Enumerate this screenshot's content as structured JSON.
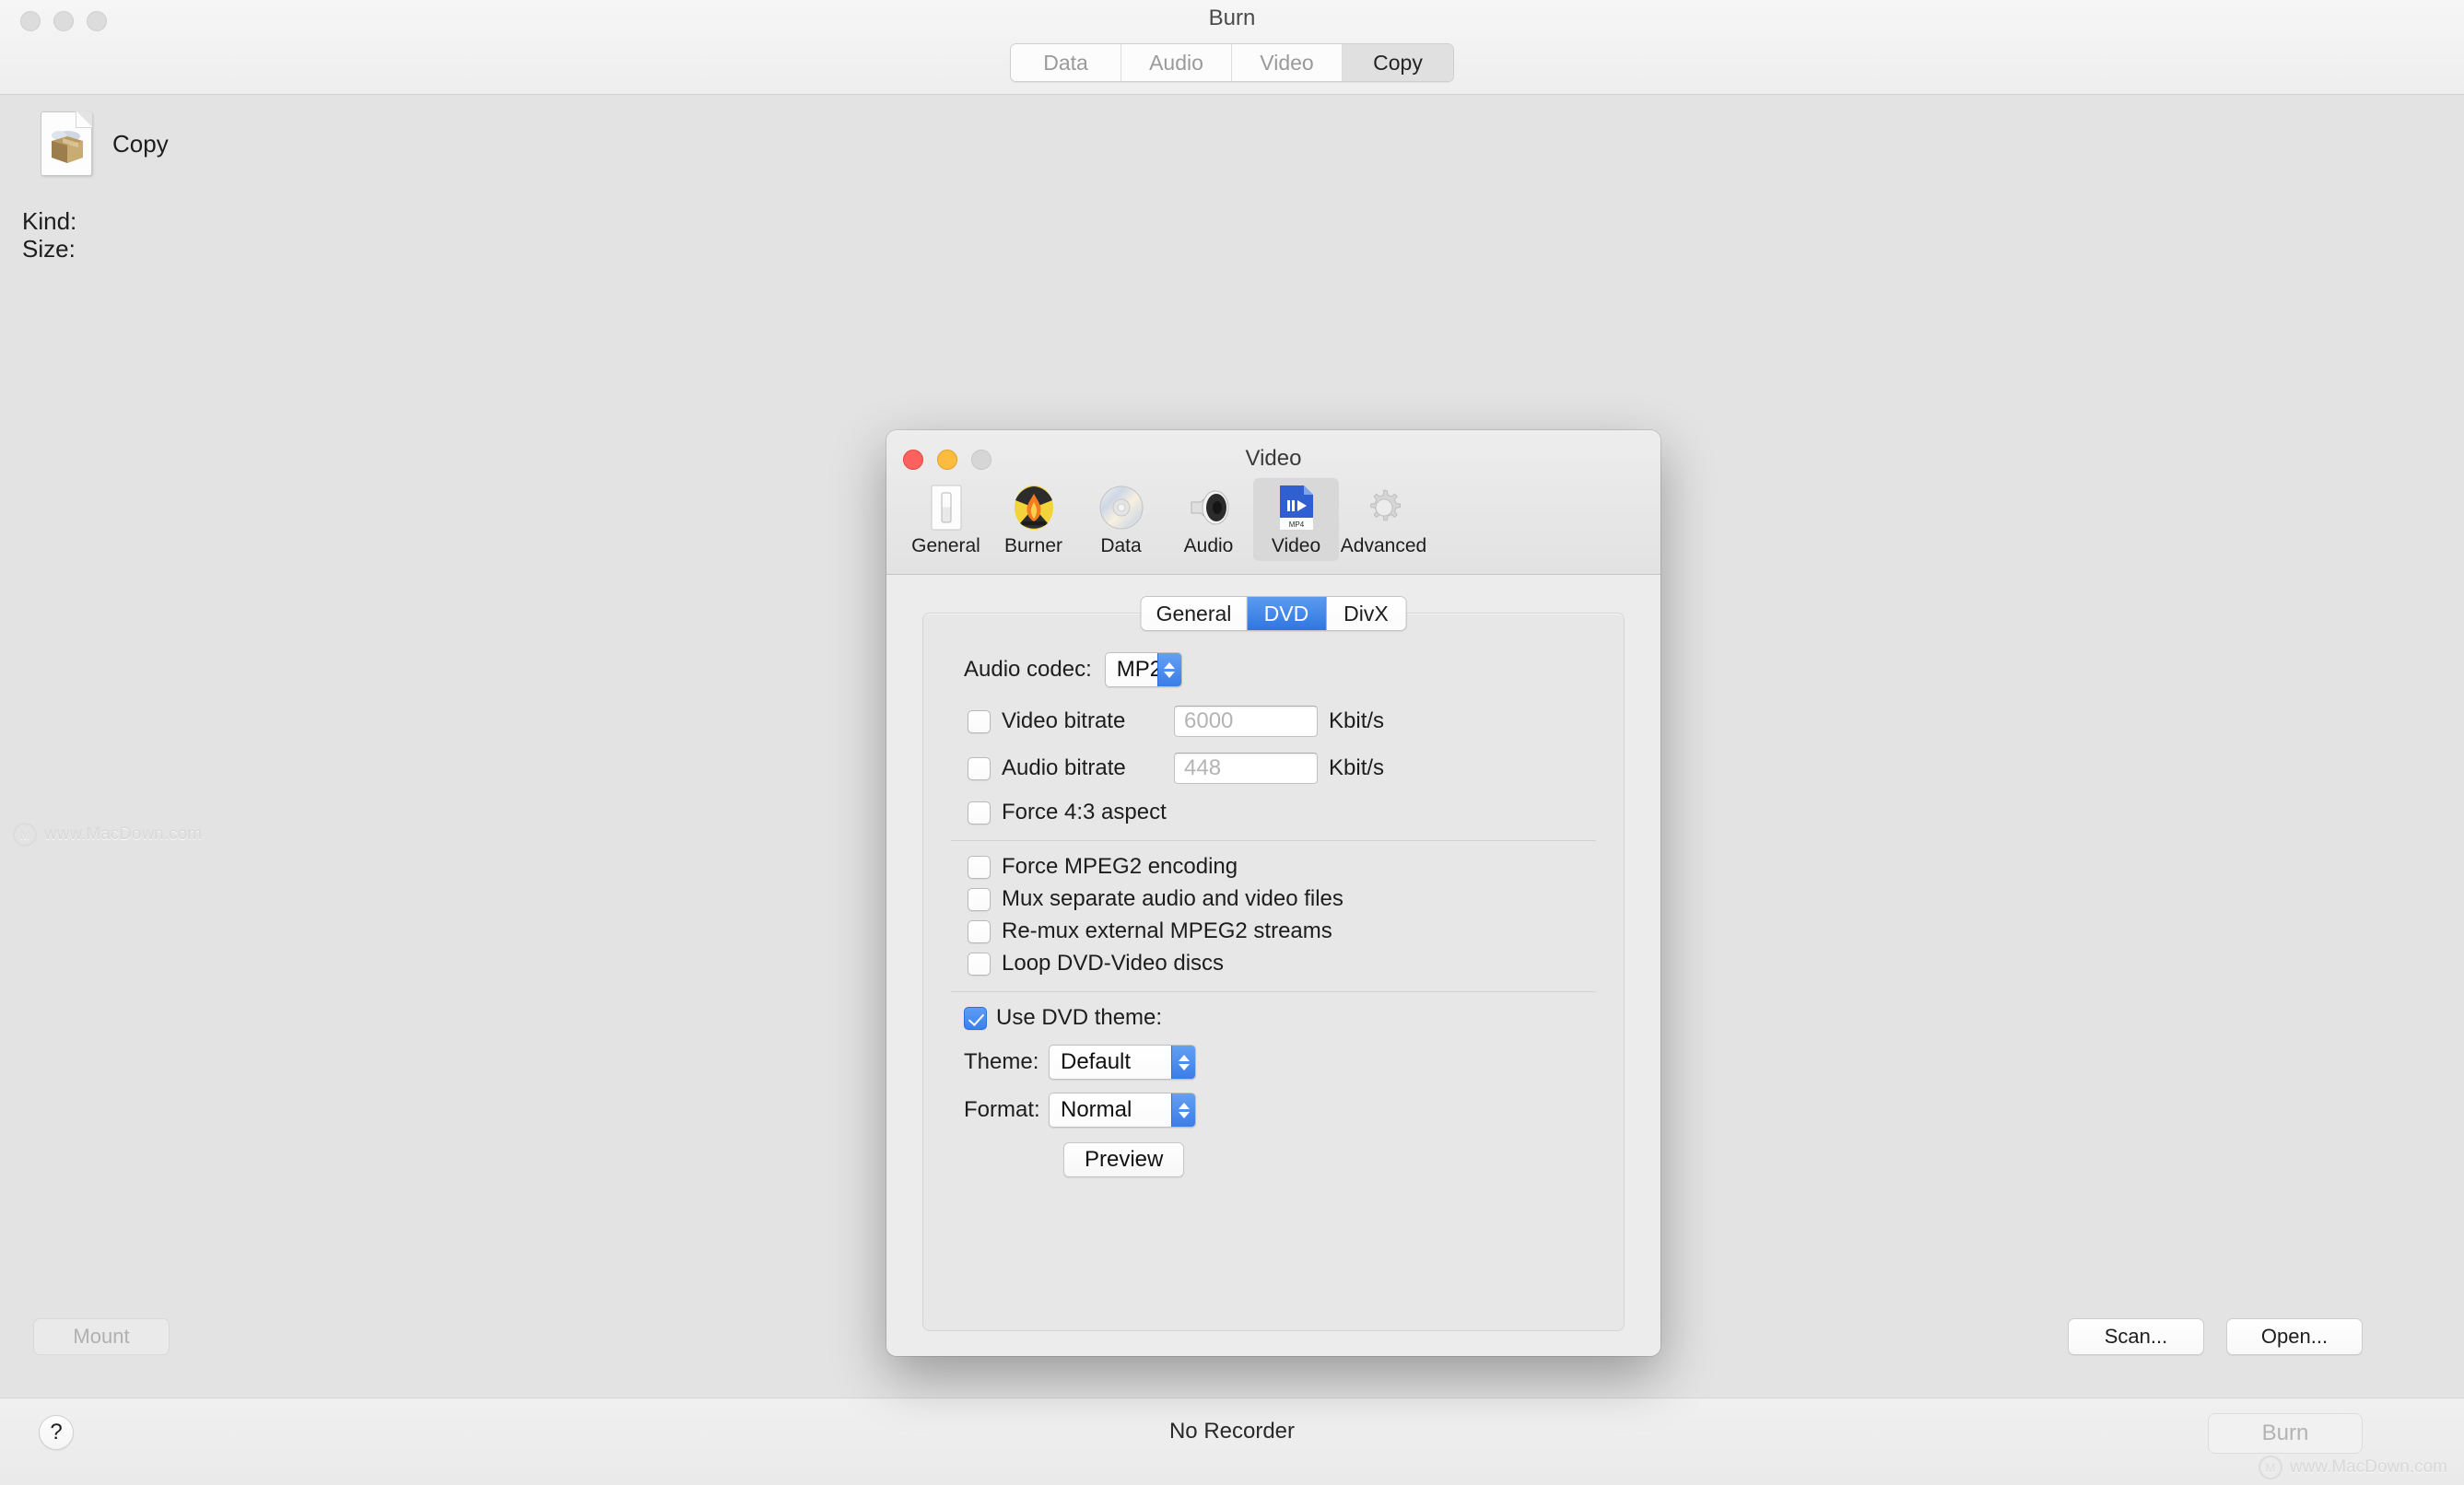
{
  "main_window": {
    "title": "Burn",
    "tabs": [
      {
        "label": "Data",
        "active": false
      },
      {
        "label": "Audio",
        "active": false
      },
      {
        "label": "Video",
        "active": false
      },
      {
        "label": "Copy",
        "active": true
      }
    ],
    "document": {
      "name": "Copy",
      "icon": "document-box-icon"
    },
    "fields": [
      {
        "label": "Kind:",
        "value": ""
      },
      {
        "label": "Size:",
        "value": ""
      }
    ],
    "kind_label": "Kind:",
    "size_label": "Size:",
    "mount_button": "Mount",
    "scan_button": "Scan...",
    "open_button": "Open...",
    "help_button": "?",
    "status": "No Recorder",
    "burn_button": "Burn",
    "watermark": "www.MacDown.com"
  },
  "prefs_window": {
    "title": "Video",
    "toolbar": [
      {
        "label": "General",
        "icon": "switch-icon",
        "selected": false
      },
      {
        "label": "Burner",
        "icon": "flame-icon",
        "selected": false
      },
      {
        "label": "Data",
        "icon": "cd-disc-icon",
        "selected": false
      },
      {
        "label": "Audio",
        "icon": "speaker-icon",
        "selected": false
      },
      {
        "label": "Video",
        "icon": "mp4-file-icon",
        "selected": true
      },
      {
        "label": "Advanced",
        "icon": "gear-icon",
        "selected": false
      }
    ],
    "inner_tabs": [
      {
        "label": "General",
        "active": false
      },
      {
        "label": "DVD",
        "active": true
      },
      {
        "label": "DivX",
        "active": false
      }
    ],
    "dvd_panel": {
      "audio_codec_label": "Audio codec:",
      "audio_codec_value": "MP2",
      "video_bitrate_label": "Video bitrate",
      "video_bitrate_checked": false,
      "video_bitrate_placeholder": "6000",
      "video_bitrate_unit": "Kbit/s",
      "audio_bitrate_label": "Audio bitrate",
      "audio_bitrate_checked": false,
      "audio_bitrate_placeholder": "448",
      "audio_bitrate_unit": "Kbit/s",
      "force_43_label": "Force 4:3 aspect",
      "force_43_checked": false,
      "options": [
        {
          "label": "Force MPEG2 encoding",
          "checked": false
        },
        {
          "label": "Mux separate audio and video files",
          "checked": false
        },
        {
          "label": "Re-mux external MPEG2 streams",
          "checked": false
        },
        {
          "label": "Loop DVD-Video discs",
          "checked": false
        }
      ],
      "use_dvd_theme_label": "Use DVD theme:",
      "use_dvd_theme_checked": true,
      "theme_label": "Theme:",
      "theme_value": "Default",
      "format_label": "Format:",
      "format_value": "Normal",
      "preview_button": "Preview"
    }
  },
  "colors": {
    "accent_blue": "#3b7de9",
    "selected_tab_blue": "#2f76e0",
    "window_gray": "#ececec",
    "desktop_gray": "#e3e3e3"
  }
}
